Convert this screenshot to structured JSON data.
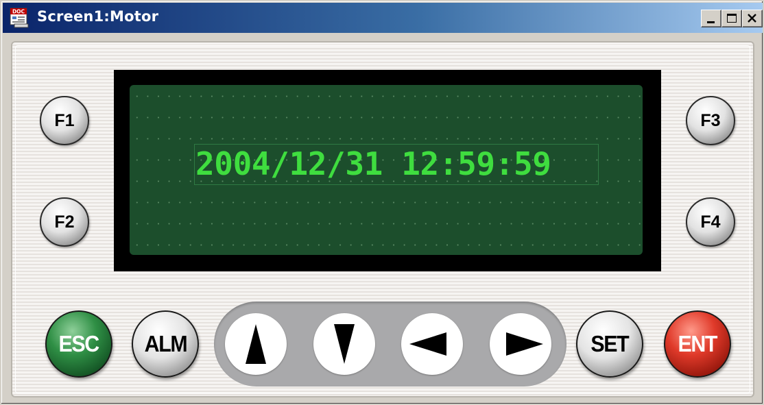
{
  "window": {
    "title": "Screen1:Motor",
    "app_icon_name": "doc-app-icon",
    "app_icon_text": "DOC",
    "controls": [
      "minimize",
      "maximize",
      "close"
    ]
  },
  "lcd": {
    "text": "2004/12/31 12:59:59",
    "text_color": "#3fdd3f",
    "background_color": "#1c4e2c"
  },
  "function_keys": {
    "f1": "F1",
    "f2": "F2",
    "f3": "F3",
    "f4": "F4"
  },
  "keys": {
    "esc": "ESC",
    "alm": "ALM",
    "set": "SET",
    "ent": "ENT"
  },
  "arrow_keys": [
    "up",
    "down",
    "left",
    "right"
  ],
  "colors": {
    "esc_key": "#2f8f45",
    "ent_key": "#e03a2a",
    "title_bar": "#0a246a"
  }
}
